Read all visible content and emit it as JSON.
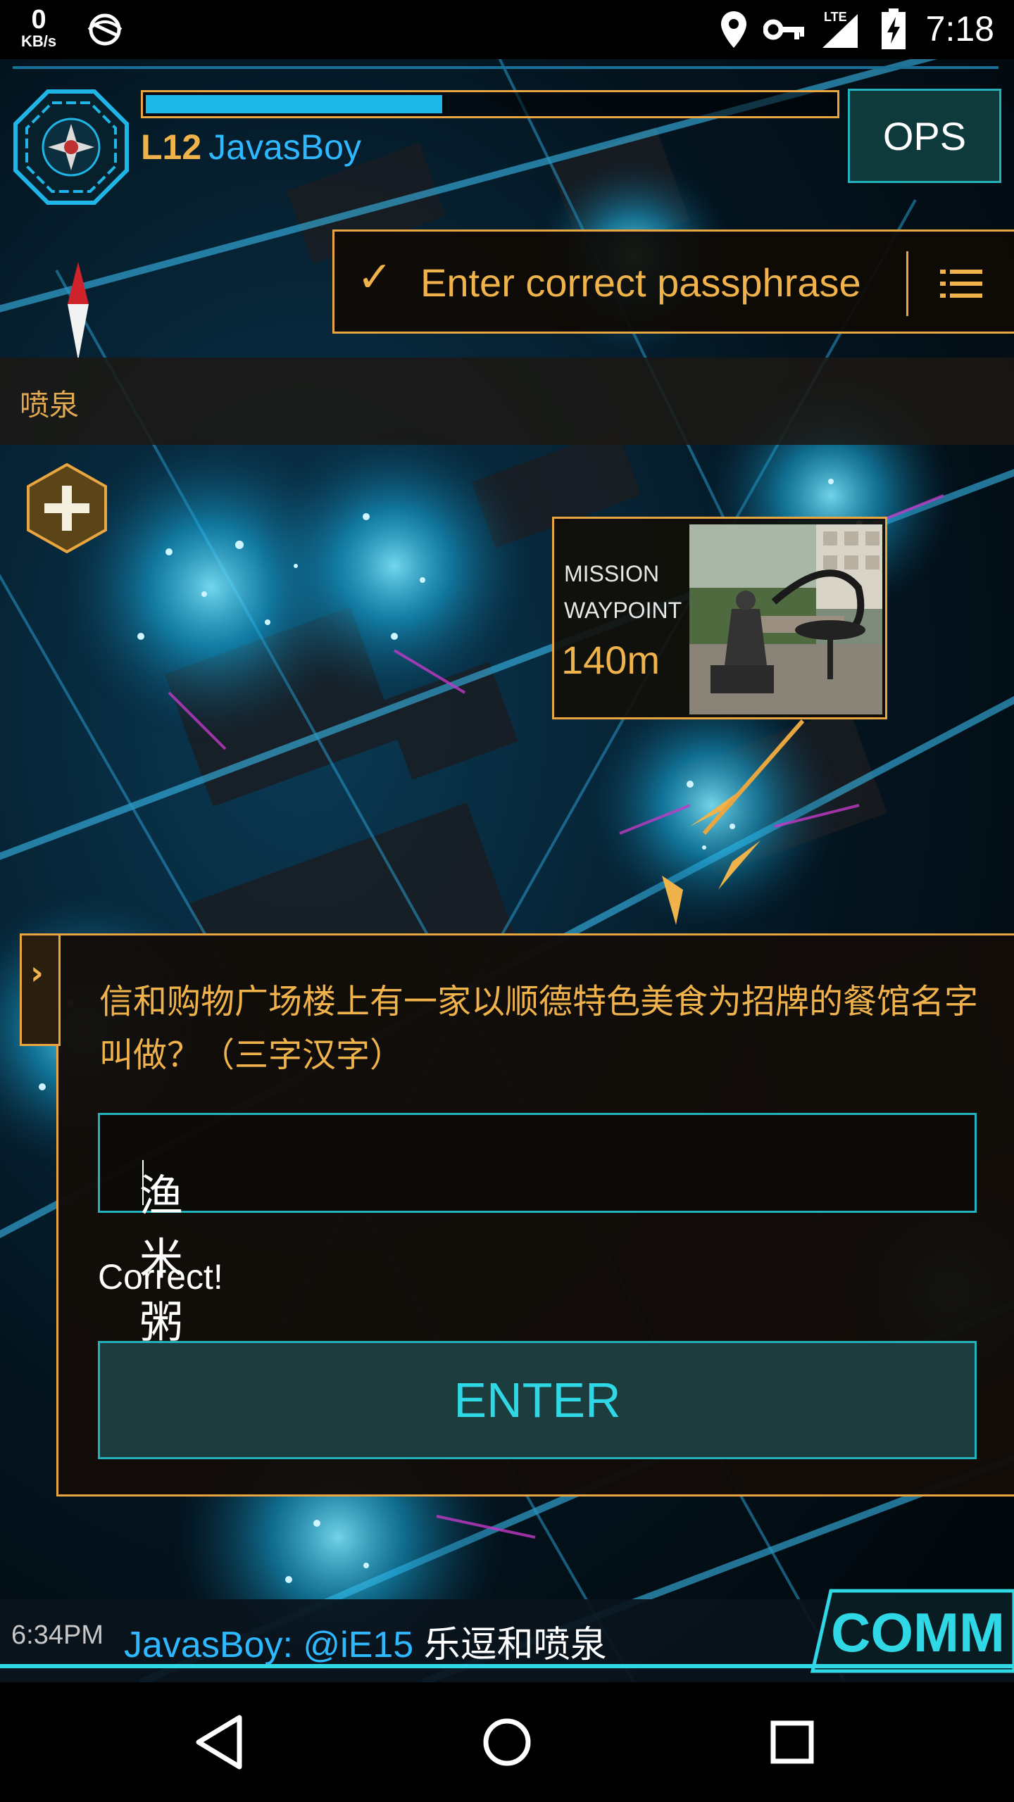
{
  "status_bar": {
    "speed_value": "0",
    "speed_unit": "KB/s",
    "network_label": "LTE",
    "time": "7:18",
    "icons": [
      "no-disturb-icon",
      "location-icon",
      "vpn-key-icon",
      "signal-icon",
      "battery-charging-icon"
    ]
  },
  "agent": {
    "level": "L12",
    "name": "JavasBoy",
    "xp_fraction": 0.43
  },
  "ops": {
    "label": "OPS"
  },
  "mission": {
    "objective": "Enter correct passphrase",
    "check_icon": "check-icon",
    "list_icon": "list-icon"
  },
  "portal": {
    "name": "喷泉"
  },
  "waypoint": {
    "title": "MISSION WAYPOINT",
    "distance": "140m"
  },
  "passphrase": {
    "question": "信和购物广场楼上有一家以顺德特色美食为招牌的餐馆名字叫做？（三字汉字）",
    "answer": "渔米粥",
    "status": "Correct!",
    "enter_label": "ENTER",
    "tab_icon": "chevron-right-icon"
  },
  "comm": {
    "time": "6:34PM",
    "sender": "JavasBoy:",
    "mention": "@iE15",
    "text": "乐逗和喷泉",
    "button_label": "COMM"
  },
  "colors": {
    "accent_orange": "#e9a640",
    "accent_cyan": "#23b2bc",
    "agent_blue": "#2eb8ff"
  }
}
